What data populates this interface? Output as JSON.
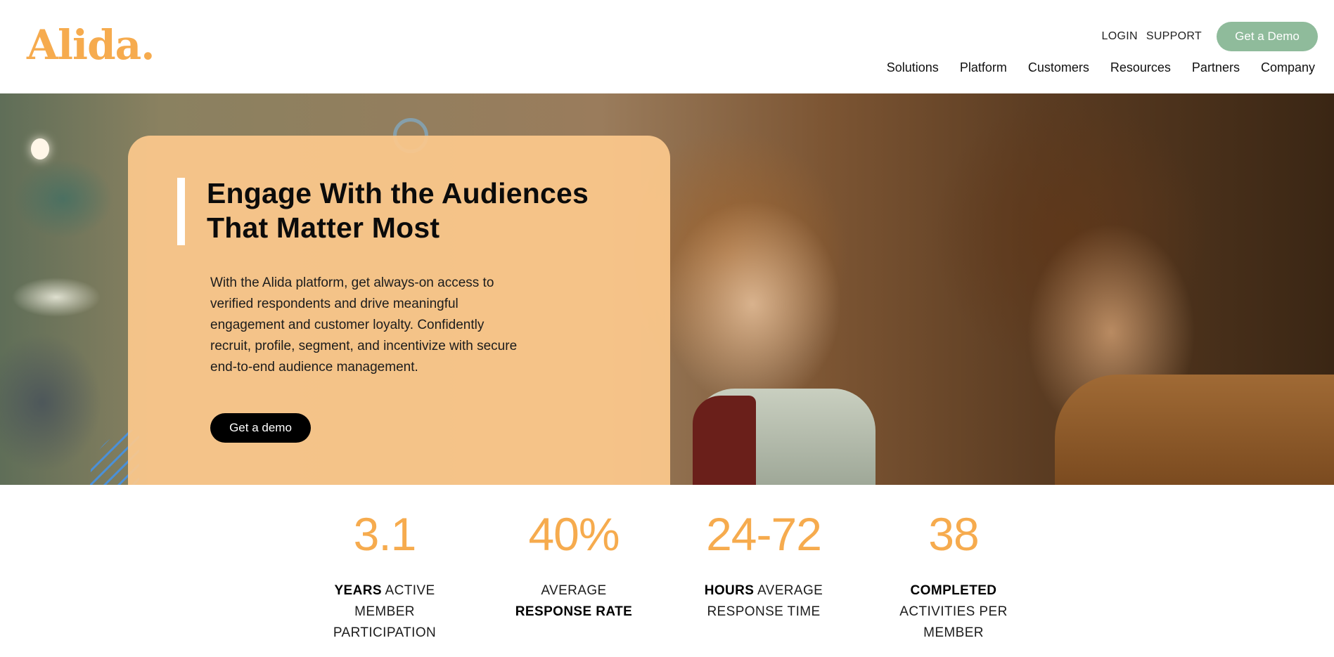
{
  "colors": {
    "brand": "#f6ab4e",
    "accent_green": "#8fbb9b",
    "card_bg": "#fcc88c",
    "stat_number": "#f6ab4e",
    "deco_blue": "#4a90d9"
  },
  "header": {
    "logo_text": "Alida.",
    "utility": {
      "login": "LOGIN",
      "support": "SUPPORT",
      "demo_button": "Get a Demo"
    },
    "nav": [
      "Solutions",
      "Platform",
      "Customers",
      "Resources",
      "Partners",
      "Company"
    ]
  },
  "hero": {
    "headline_line1": "Engage With the Audiences",
    "headline_line2": "That Matter Most",
    "body_lines": [
      "With the Alida platform, get always-on access to",
      "verified respondents and drive meaningful",
      "engagement and customer loyalty. Confidently",
      "recruit, profile, segment, and incentivize with secure",
      "end-to-end audience management."
    ],
    "cta": "Get a demo",
    "image_icon": "photo-two-smiling-women"
  },
  "stats": [
    {
      "value": "3.1",
      "label_bold": "YEARS",
      "label_rest": " ACTIVE",
      "line2": "MEMBER",
      "line3": "PARTICIPATION"
    },
    {
      "value": "40%",
      "label_line1": "AVERAGE",
      "label_bold_line2": "RESPONSE RATE"
    },
    {
      "value": "24-72",
      "label_bold": "HOURS",
      "label_rest": " AVERAGE",
      "line2": "RESPONSE TIME"
    },
    {
      "value": "38",
      "label_bold_line1": "COMPLETED",
      "line2": "ACTIVITIES PER",
      "line3": "MEMBER"
    }
  ]
}
